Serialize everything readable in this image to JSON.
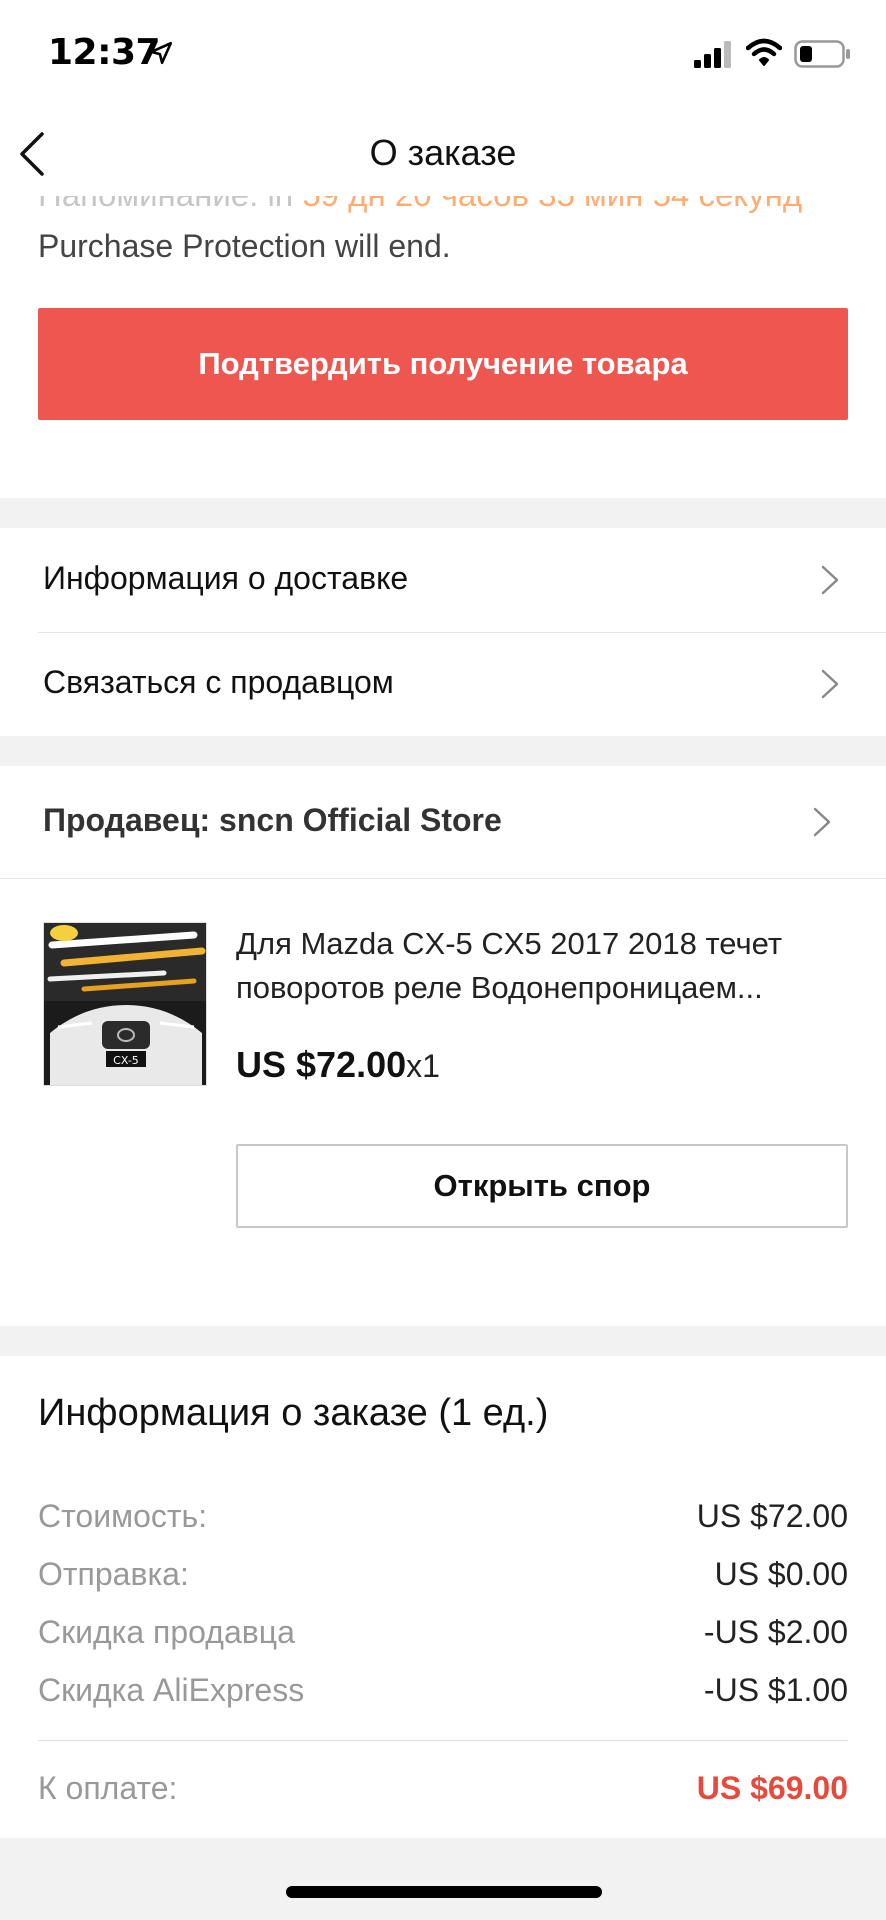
{
  "status_bar": {
    "time": "12:37"
  },
  "nav": {
    "title": "О заказе"
  },
  "top": {
    "reminder_prefix": "Напоминание: in ",
    "reminder_time": "59 дн 20 часов 35 мин 54 секунд",
    "protection_text": "Purchase Protection will end.",
    "confirm_label": "Подтвердить получение товара"
  },
  "menu": {
    "items": [
      {
        "label": "Информация о доставке"
      },
      {
        "label": "Связаться с продавцом"
      }
    ]
  },
  "store": {
    "seller": "Продавец: sncn Official Store",
    "product": {
      "title": "Для Mazda CX-5 CX5 2017 2018 течет поворотов реле Водонепроницаем...",
      "price": "US $72.00",
      "qty": "x1",
      "image_badge": "CX-5"
    },
    "dispute_label": "Открыть спор"
  },
  "order": {
    "title": "Информация о заказе (1 ед.)",
    "rows": [
      {
        "label": "Стоимость:",
        "value": "US $72.00"
      },
      {
        "label": "Отправка:",
        "value": "US $0.00"
      },
      {
        "label": "Скидка продавца",
        "value": "-US $2.00"
      },
      {
        "label": "Скидка AliExpress",
        "value": "-US $1.00"
      }
    ],
    "total_label": "К оплате:",
    "total_value": "US $69.00"
  },
  "colors": {
    "accent": "#ee5650",
    "countdown": "#ff6a00",
    "total": "#e64a3c"
  },
  "icons": [
    "location-arrow-icon",
    "signal-icon",
    "wifi-icon",
    "battery-icon",
    "back-chevron-icon",
    "chevron-right-icon"
  ]
}
